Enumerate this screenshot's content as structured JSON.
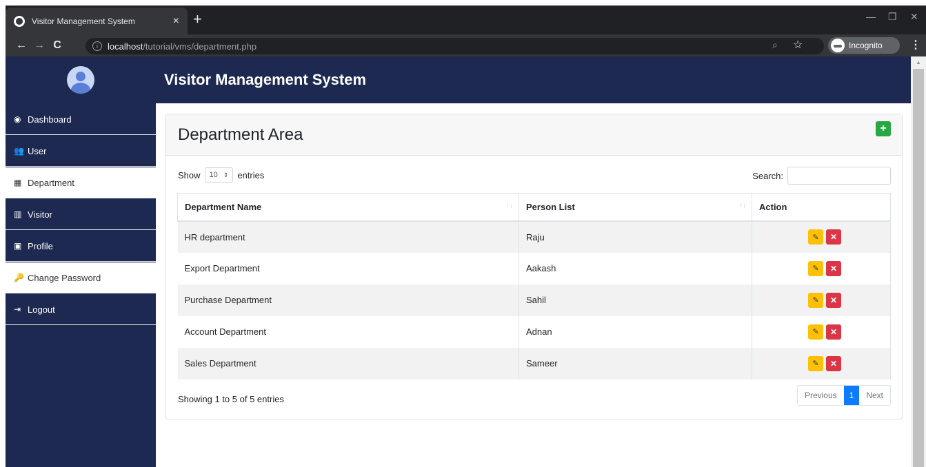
{
  "browser": {
    "tab_title": "Visitor Management System",
    "tab_close": "×",
    "new_tab": "+",
    "url_host": "localhost",
    "url_path": "/tutorial/vms/department.php",
    "incognito_label": "Incognito",
    "window_controls": [
      "—",
      "❐",
      "✕"
    ]
  },
  "app": {
    "title": "Visitor Management System",
    "colors": {
      "nav_dark": "#1d2951",
      "success": "#28a745",
      "warning": "#ffc107",
      "danger": "#dc3545",
      "primary": "#0d7bff"
    }
  },
  "sidebar": {
    "items": [
      {
        "label": "Dashboard",
        "icon": "tachometer-icon",
        "glyph": "◉",
        "light": false
      },
      {
        "label": "User",
        "icon": "users-icon",
        "glyph": "👥",
        "light": false
      },
      {
        "label": "Department",
        "icon": "building-icon",
        "glyph": "▦",
        "light": true
      },
      {
        "label": "Visitor",
        "icon": "id-card-icon",
        "glyph": "▥",
        "light": false
      },
      {
        "label": "Profile",
        "icon": "profile-icon",
        "glyph": "▣",
        "light": false
      },
      {
        "label": "Change Password",
        "icon": "key-icon",
        "glyph": "🔑",
        "light": true
      },
      {
        "label": "Logout",
        "icon": "logout-icon",
        "glyph": "⇥",
        "light": false
      }
    ]
  },
  "card": {
    "title": "Department Area",
    "add_label": "+"
  },
  "table_controls": {
    "show_label": "Show",
    "length_value": "10",
    "entries_label": "entries",
    "search_label": "Search:",
    "search_value": ""
  },
  "table": {
    "headers": [
      "Department Name",
      "Person List",
      "Action"
    ],
    "rows": [
      {
        "department": "HR department",
        "person": "Raju"
      },
      {
        "department": "Export Department",
        "person": "Aakash"
      },
      {
        "department": "Purchase Department",
        "person": "Sahil"
      },
      {
        "department": "Account Department",
        "person": "Adnan"
      },
      {
        "department": "Sales Department",
        "person": "Sameer"
      }
    ]
  },
  "footer": {
    "info": "Showing 1 to 5 of 5 entries",
    "prev": "Previous",
    "page": "1",
    "next": "Next"
  }
}
